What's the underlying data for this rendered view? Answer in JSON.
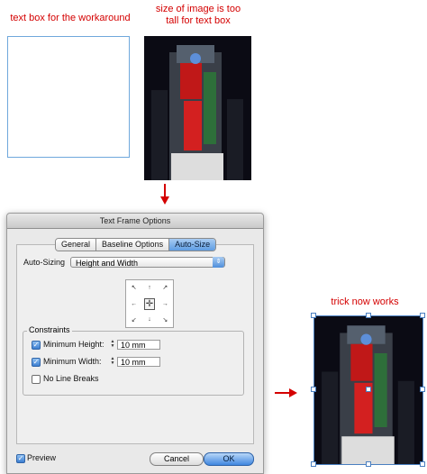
{
  "annotations": {
    "text_box_caption": "text box for the workaround",
    "image_caption_line1": "size of image is too",
    "image_caption_line2": "tall for text box",
    "result_caption": "trick now works"
  },
  "colors": {
    "annotation": "#d40000",
    "frame_border": "#6fa8dc",
    "accent": "#3f86df"
  },
  "dialog": {
    "title": "Text Frame Options",
    "tabs": [
      {
        "label": "General",
        "active": false
      },
      {
        "label": "Baseline Options",
        "active": false
      },
      {
        "label": "Auto-Size",
        "active": true
      }
    ],
    "auto_sizing_label": "Auto-Sizing",
    "auto_sizing_value": "Height and Width",
    "reference_grid_icons": [
      "arrow-top-left-icon",
      "arrow-top-icon",
      "arrow-top-right-icon",
      "arrow-left-icon",
      "center-icon",
      "arrow-right-icon",
      "arrow-bottom-left-icon",
      "arrow-bottom-icon",
      "arrow-bottom-right-icon"
    ],
    "constraints_label": "Constraints",
    "min_height": {
      "label": "Minimum Height:",
      "value": "10 mm",
      "checked": true
    },
    "min_width": {
      "label": "Minimum Width:",
      "value": "10 mm",
      "checked": true
    },
    "no_line_breaks": {
      "label": "No Line Breaks",
      "checked": false
    },
    "preview": {
      "label": "Preview",
      "checked": true
    },
    "cancel_label": "Cancel",
    "ok_label": "OK"
  }
}
